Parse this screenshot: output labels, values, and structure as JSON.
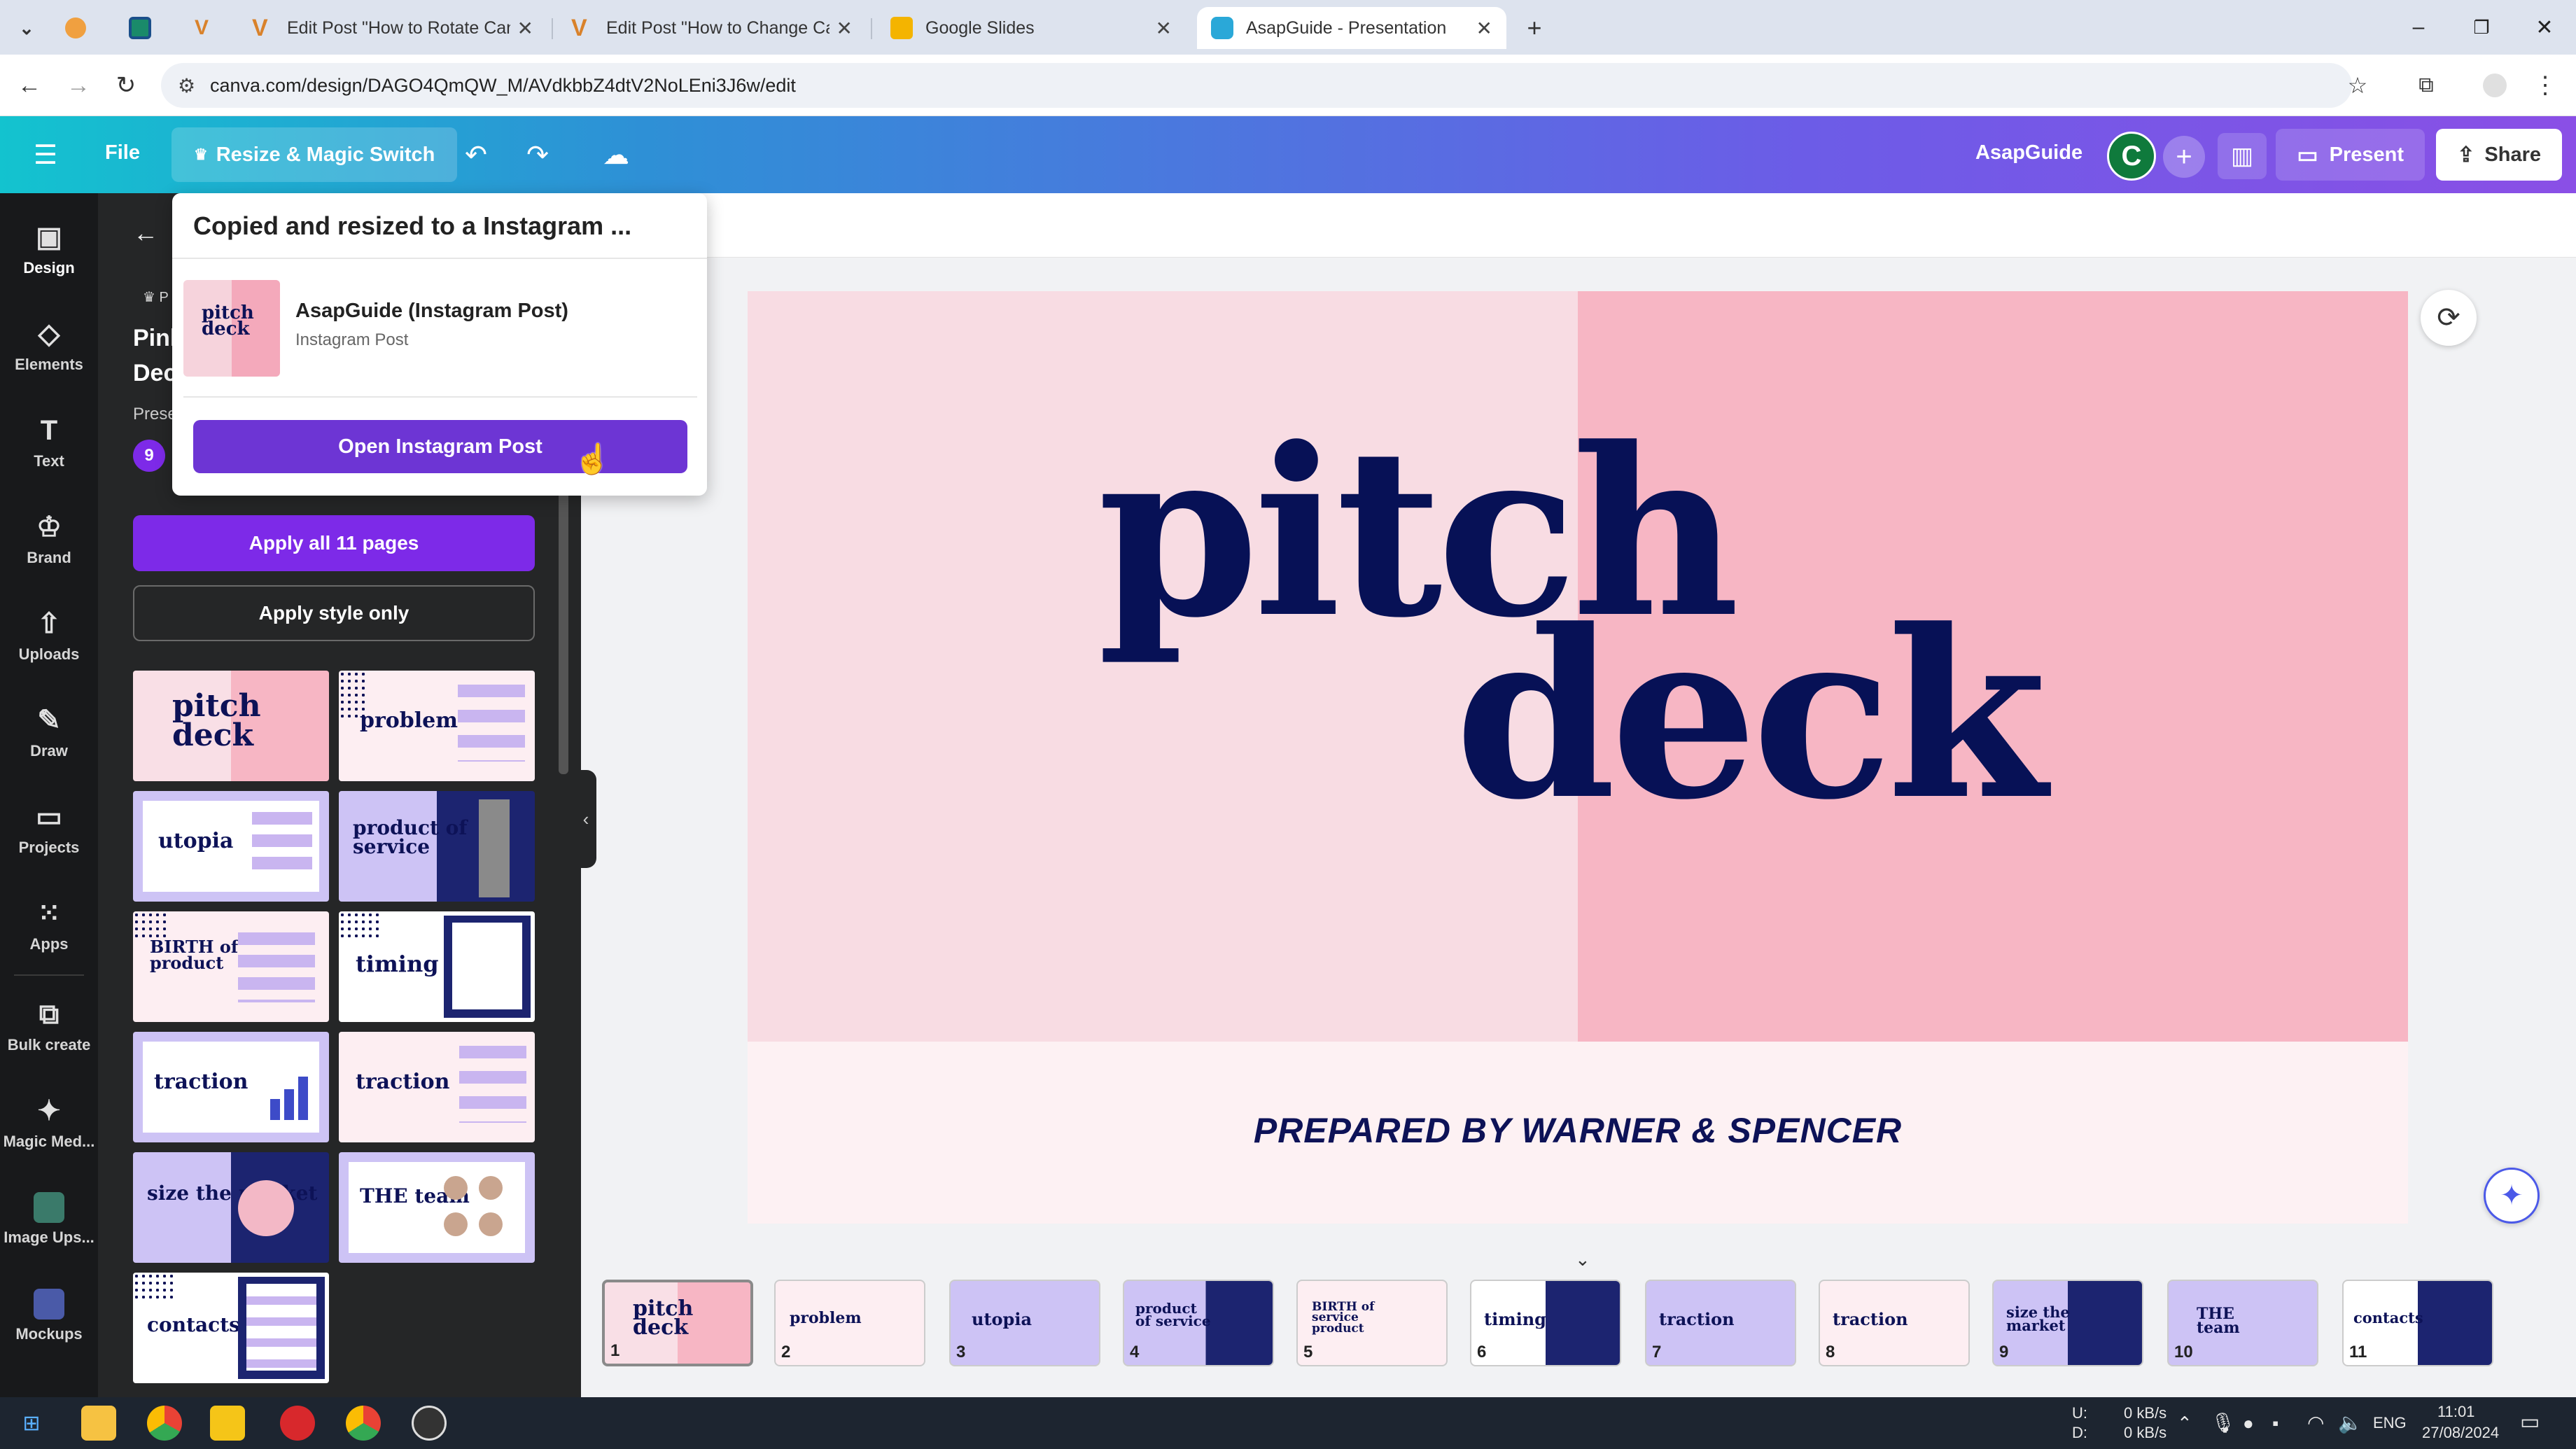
{
  "browser": {
    "tabs": [
      {
        "title": "Edit Post \"How to Rotate Canva"
      },
      {
        "title": "Edit Post \"How to Change Canv"
      },
      {
        "title": "Google Slides"
      },
      {
        "title": "AsapGuide - Presentation"
      }
    ],
    "url": "canva.com/design/DAGO4QmQW_M/AVdkbbZ4dtV2NoLEni3J6w/edit",
    "new_tab": "+",
    "close": "✕"
  },
  "header": {
    "file": "File",
    "resize": "Resize & Magic Switch",
    "brand": "AsapGuide",
    "avatar_letter": "C",
    "present": "Present",
    "share": "Share"
  },
  "rail": [
    {
      "label": "Design",
      "icon": "design-icon"
    },
    {
      "label": "Elements",
      "icon": "elements-icon"
    },
    {
      "label": "Text",
      "icon": "text-icon"
    },
    {
      "label": "Brand",
      "icon": "brand-icon"
    },
    {
      "label": "Uploads",
      "icon": "uploads-icon"
    },
    {
      "label": "Draw",
      "icon": "draw-icon"
    },
    {
      "label": "Projects",
      "icon": "projects-icon"
    },
    {
      "label": "Apps",
      "icon": "apps-icon"
    },
    {
      "label": "Bulk create",
      "icon": "bulk-create-icon"
    },
    {
      "label": "Magic Med...",
      "icon": "magic-media-icon"
    },
    {
      "label": "Image Ups...",
      "icon": "image-upscaler-icon"
    },
    {
      "label": "Mockups",
      "icon": "mockups-icon"
    }
  ],
  "panel": {
    "title_line1": "Pink",
    "title_line2": "Deck",
    "subtitle": "Prese",
    "badge": "9",
    "apply_all": "Apply all 11 pages",
    "apply_style": "Apply style only",
    "thumbs": [
      {
        "title": "pitch deck"
      },
      {
        "title": "problem"
      },
      {
        "title": "utopia"
      },
      {
        "title": "product of service"
      },
      {
        "title": "BIRTH of service product"
      },
      {
        "title": "timing"
      },
      {
        "title": "traction"
      },
      {
        "title": "traction"
      },
      {
        "title": "size the market"
      },
      {
        "title": "THE team"
      },
      {
        "title": "contacts"
      }
    ]
  },
  "popup": {
    "title": "Copied and resized to a Instagram ...",
    "item_name": "AsapGuide (Instagram Post)",
    "item_type": "Instagram Post",
    "thumb_text": "pitch deck",
    "open_button": "Open Instagram Post"
  },
  "slide": {
    "word1": "pitch",
    "word2": "deck",
    "footer": "PREPARED BY WARNER & SPENCER",
    "colors": {
      "left": "#f8dce3",
      "right": "#f7b6c4",
      "bottom": "#fdf1f3",
      "text": "#071156"
    }
  },
  "filmstrip": [
    {
      "num": "1",
      "title": "pitch deck"
    },
    {
      "num": "2",
      "title": "problem"
    },
    {
      "num": "3",
      "title": "utopia"
    },
    {
      "num": "4",
      "title": "product of service"
    },
    {
      "num": "5",
      "title": "BIRTH of service product"
    },
    {
      "num": "6",
      "title": "timing"
    },
    {
      "num": "7",
      "title": "traction"
    },
    {
      "num": "8",
      "title": "traction"
    },
    {
      "num": "9",
      "title": "size the market"
    },
    {
      "num": "10",
      "title": "THE team"
    },
    {
      "num": "11",
      "title": "contacts"
    }
  ],
  "taskbar": {
    "net_up_label": "U:",
    "net_down_label": "D:",
    "net_up": "0 kB/s",
    "net_down": "0 kB/s",
    "lang": "ENG",
    "time": "11:01",
    "date": "27/08/2024"
  }
}
